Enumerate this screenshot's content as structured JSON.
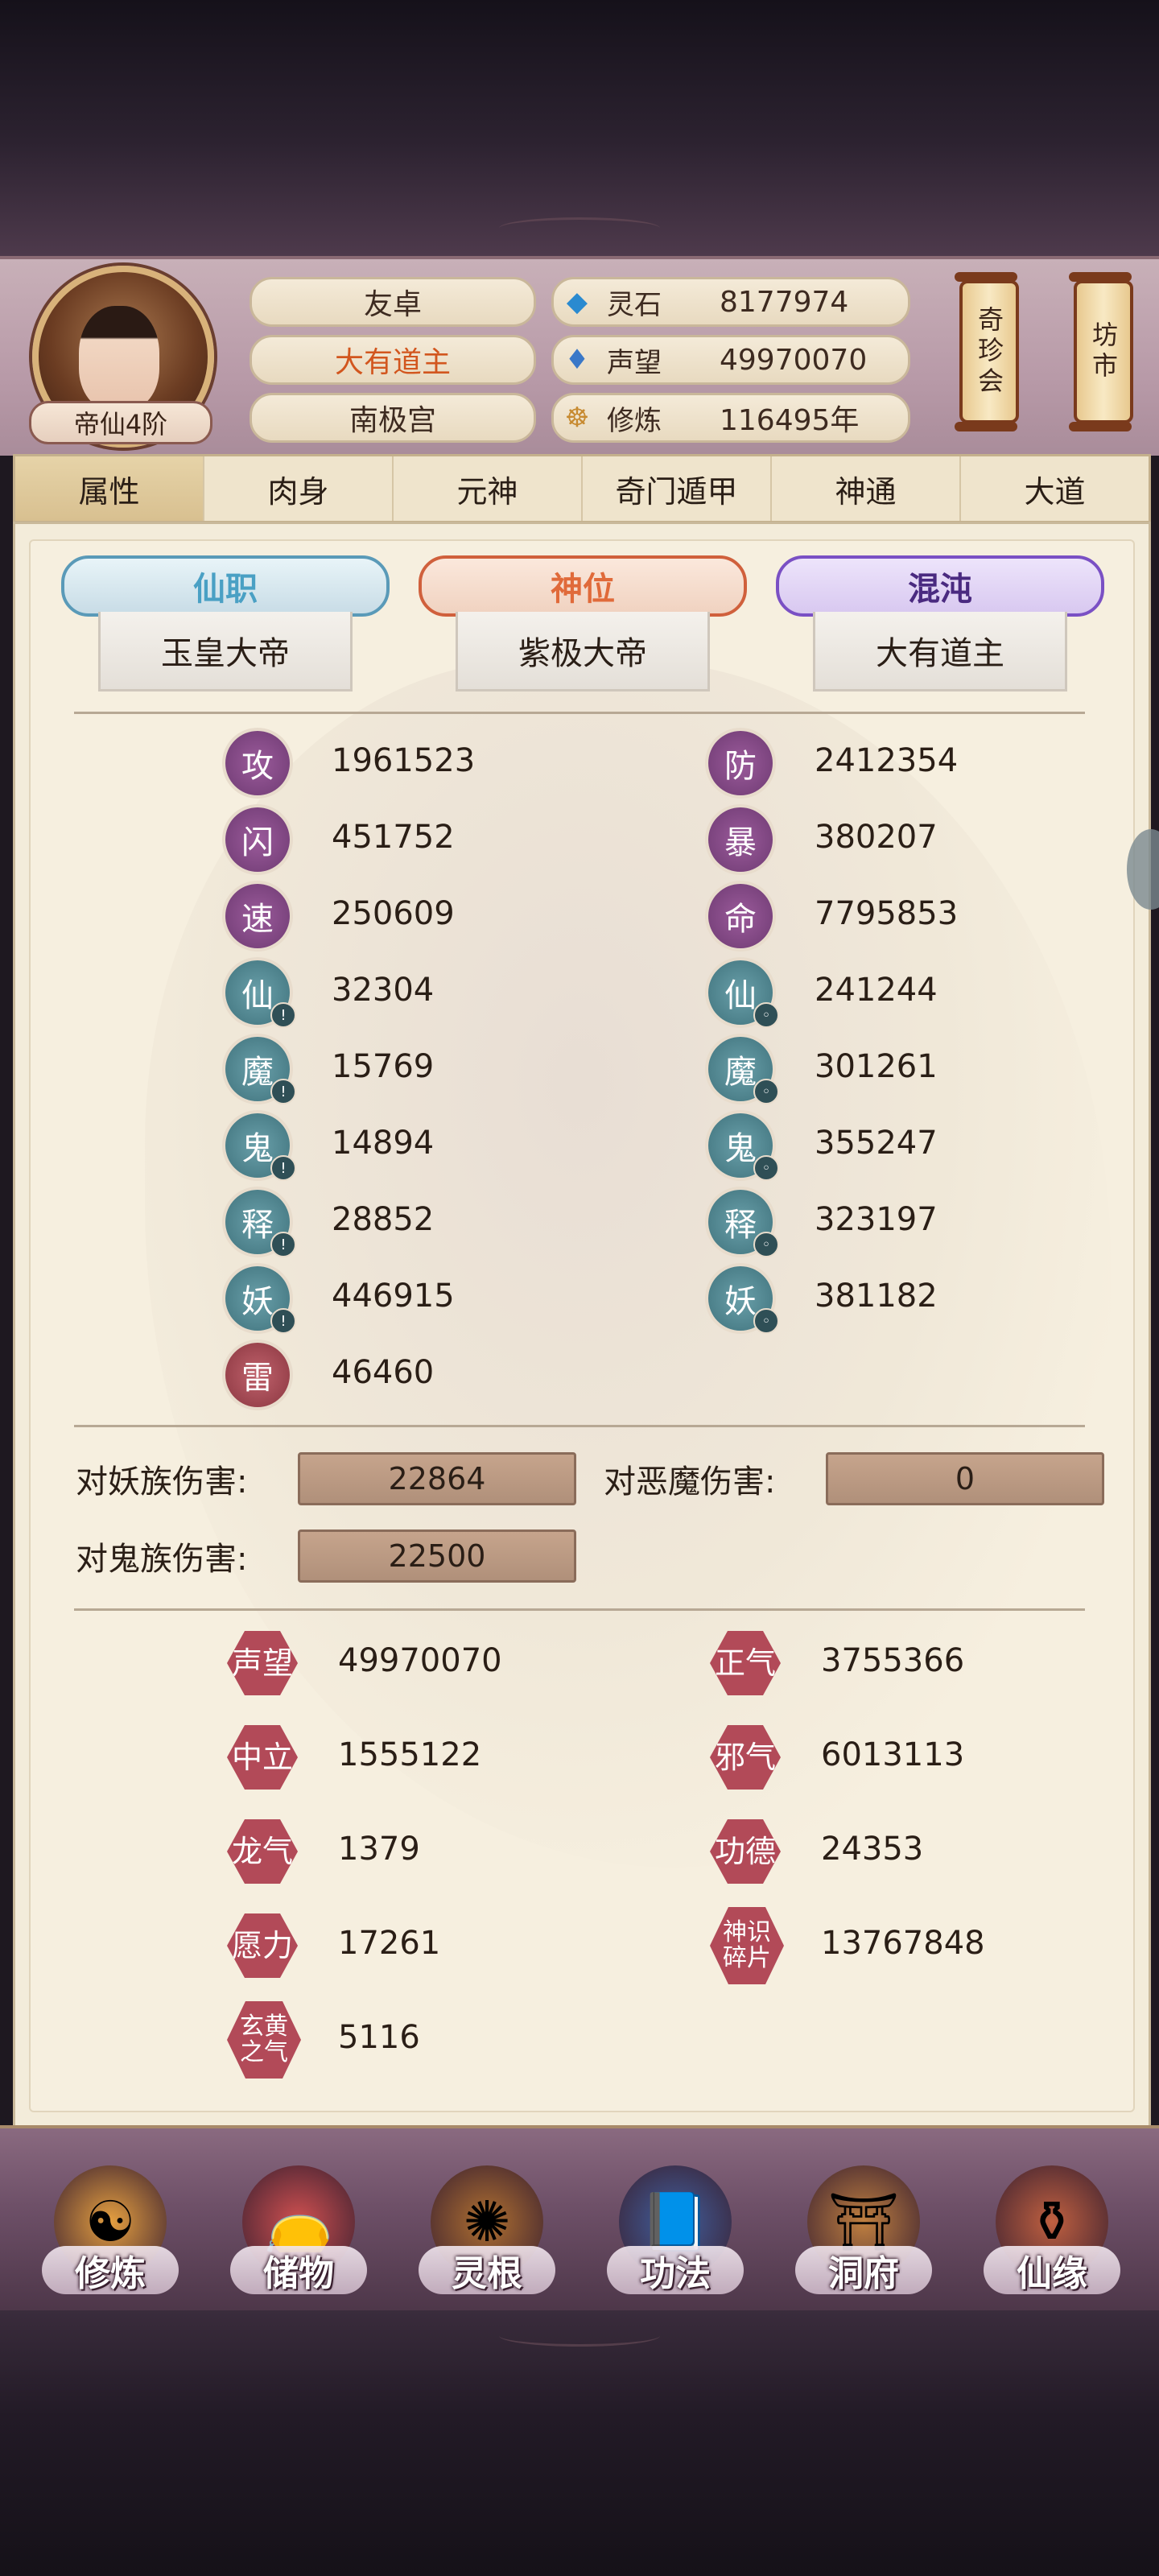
{
  "header": {
    "rank": "帝仙4阶",
    "names": [
      "友卓",
      "大有道主",
      "南极宫"
    ],
    "name_colors": [
      "#3d2a20",
      "#d2561e",
      "#3d2a20"
    ],
    "resources": [
      {
        "icon": "spirit-stone-icon",
        "label": "灵石",
        "value": "8177974"
      },
      {
        "icon": "prestige-drop-icon",
        "label": "声望",
        "value": "49970070"
      },
      {
        "icon": "meditation-icon",
        "label": "修炼",
        "value": "116495年"
      }
    ],
    "buttons": [
      "奇珍会",
      "坊市"
    ]
  },
  "tabs": [
    "属性",
    "肉身",
    "元神",
    "奇门遁甲",
    "神通",
    "大道"
  ],
  "titles": [
    {
      "badge": "仙职",
      "value": "玉皇大帝",
      "color": "#4aa0c4"
    },
    {
      "badge": "神位",
      "value": "紫极大帝",
      "color": "#e06a3a"
    },
    {
      "badge": "混沌",
      "value": "大有道主",
      "color": "#7a50c4"
    }
  ],
  "stats_left": [
    {
      "char": "攻",
      "value": "1961523",
      "style": "purple",
      "sub": ""
    },
    {
      "char": "闪",
      "value": "451752",
      "style": "purple",
      "sub": ""
    },
    {
      "char": "速",
      "value": "250609",
      "style": "purple",
      "sub": ""
    },
    {
      "char": "仙",
      "value": "32304",
      "style": "teal",
      "sub": "!"
    },
    {
      "char": "魔",
      "value": "15769",
      "style": "teal",
      "sub": "!"
    },
    {
      "char": "鬼",
      "value": "14894",
      "style": "teal",
      "sub": "!"
    },
    {
      "char": "释",
      "value": "28852",
      "style": "teal",
      "sub": "!"
    },
    {
      "char": "妖",
      "value": "446915",
      "style": "teal",
      "sub": "!"
    },
    {
      "char": "雷",
      "value": "46460",
      "style": "red",
      "sub": ""
    }
  ],
  "stats_right": [
    {
      "char": "防",
      "value": "2412354",
      "style": "purple",
      "sub": ""
    },
    {
      "char": "暴",
      "value": "380207",
      "style": "purple",
      "sub": ""
    },
    {
      "char": "命",
      "value": "7795853",
      "style": "purple",
      "sub": ""
    },
    {
      "char": "仙",
      "value": "241244",
      "style": "teal",
      "sub": "o"
    },
    {
      "char": "魔",
      "value": "301261",
      "style": "teal",
      "sub": "o"
    },
    {
      "char": "鬼",
      "value": "355247",
      "style": "teal",
      "sub": "o"
    },
    {
      "char": "释",
      "value": "323197",
      "style": "teal",
      "sub": "o"
    },
    {
      "char": "妖",
      "value": "381182",
      "style": "teal",
      "sub": "o"
    }
  ],
  "damage": [
    {
      "label": "对妖族伤害:",
      "value": "22864"
    },
    {
      "label": "对恶魔伤害:",
      "value": "0"
    },
    {
      "label": "对鬼族伤害:",
      "value": "22500"
    }
  ],
  "extra_left": [
    {
      "char": "声望",
      "value": "49970070"
    },
    {
      "char": "中立",
      "value": "1555122"
    },
    {
      "char": "龙气",
      "value": "1379"
    },
    {
      "char": "愿力",
      "value": "17261"
    },
    {
      "char": "玄黄之气",
      "value": "5116"
    }
  ],
  "extra_right": [
    {
      "char": "正气",
      "value": "3755366"
    },
    {
      "char": "邪气",
      "value": "6013113"
    },
    {
      "char": "功德",
      "value": "24353"
    },
    {
      "char": "神识碎片",
      "value": "13767848"
    }
  ],
  "nav": [
    {
      "label": "修炼",
      "icon": "cultivate-icon"
    },
    {
      "label": "储物",
      "icon": "storage-bag-icon"
    },
    {
      "label": "灵根",
      "icon": "spirit-root-icon"
    },
    {
      "label": "功法",
      "icon": "scripture-book-icon"
    },
    {
      "label": "洞府",
      "icon": "cave-dwelling-icon"
    },
    {
      "label": "仙缘",
      "icon": "gourd-icon"
    }
  ]
}
